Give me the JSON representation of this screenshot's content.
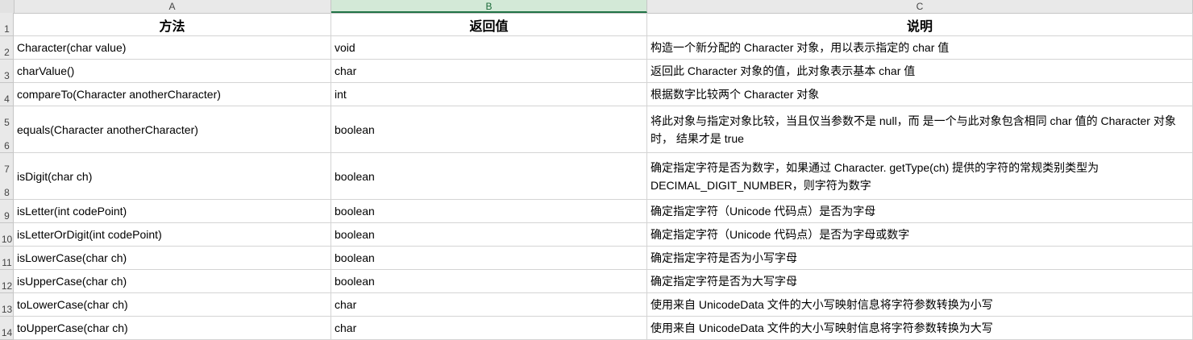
{
  "columns": [
    "A",
    "B",
    "C"
  ],
  "header": {
    "method": "方法",
    "return": "返回值",
    "desc": "说明"
  },
  "row_numbers": [
    "1",
    "2",
    "3",
    "4",
    "5",
    "6",
    "7",
    "8",
    "9",
    "10",
    "11",
    "12",
    "13",
    "14"
  ],
  "rows": [
    {
      "method": "Character(char value)",
      "return": "void",
      "desc": "构造一个新分配的 Character 对象，用以表示指定的 char 值"
    },
    {
      "method": "charValue()",
      "return": "char",
      "desc": "返回此 Character 对象的值，此对象表示基本 char 值"
    },
    {
      "method": "compareTo(Character anotherCharacter)",
      "return": "int",
      "desc": "根据数字比较两个 Character 对象"
    },
    {
      "method": "equals(Character anotherCharacter)",
      "return": "boolean",
      "desc": "将此对象与指定对象比较，当且仅当参数不是 null，而 是一个与此对象包含相同 char 值的 Character 对象时， 结果才是 true"
    },
    {
      "method": "isDigit(char ch)",
      "return": "boolean",
      "desc": "确定指定字符是否为数字，如果通过 Character. getType(ch) 提供的字符的常规类别类型为 DECIMAL_DIGIT_NUMBER，则字符为数字"
    },
    {
      "method": "isLetter(int codePoint)",
      "return": "boolean",
      "desc": "确定指定字符（Unicode 代码点）是否为字母"
    },
    {
      "method": "isLetterOrDigit(int codePoint)",
      "return": "boolean",
      "desc": "确定指定字符（Unicode 代码点）是否为字母或数字"
    },
    {
      "method": "isLowerCase(char ch)",
      "return": "boolean",
      "desc": "确定指定字符是否为小写字母"
    },
    {
      "method": "isUpperCase(char ch)",
      "return": "boolean",
      "desc": "确定指定字符是否为大写字母"
    },
    {
      "method": "toLowerCase(char ch)",
      "return": "char",
      "desc": "使用来自 UnicodeData 文件的大小写映射信息将字符参数转换为小写"
    },
    {
      "method": "toUpperCase(char ch)",
      "return": "char",
      "desc": "使用来自 UnicodeData 文件的大小写映射信息将字符参数转换为大写"
    }
  ],
  "selected_column": "B"
}
